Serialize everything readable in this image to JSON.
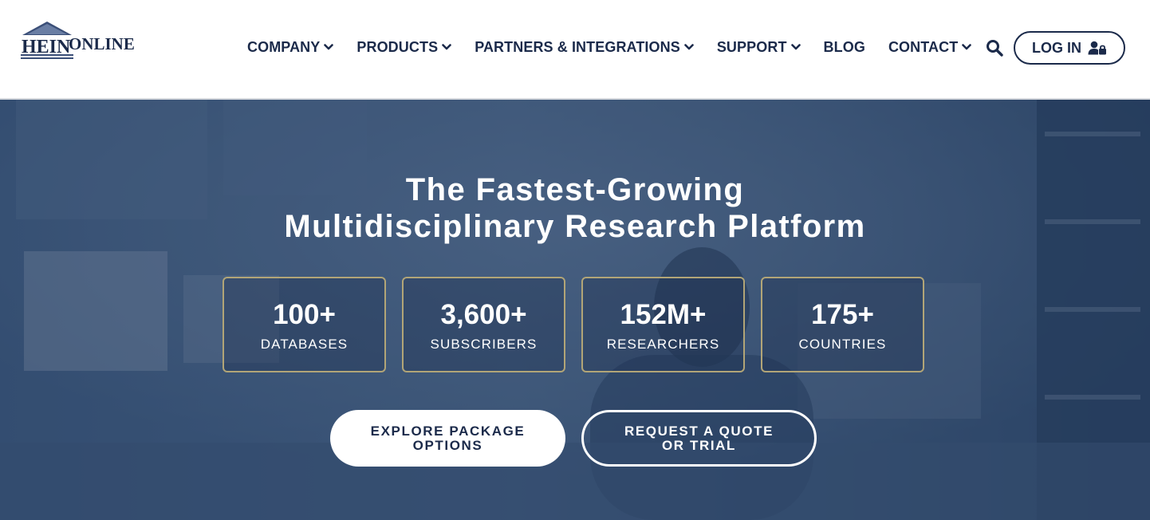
{
  "brand": {
    "logo_text_primary": "HEIN",
    "logo_text_secondary": "ONLINE",
    "colors": {
      "navy": "#1b2a4a",
      "gold": "#b2a577",
      "white": "#ffffff"
    }
  },
  "nav": {
    "items": [
      {
        "label": "COMPANY",
        "has_dropdown": true
      },
      {
        "label": "PRODUCTS",
        "has_dropdown": true
      },
      {
        "label": "PARTNERS & INTEGRATIONS",
        "has_dropdown": true
      },
      {
        "label": "SUPPORT",
        "has_dropdown": true
      },
      {
        "label": "BLOG",
        "has_dropdown": false
      },
      {
        "label": "CONTACT",
        "has_dropdown": true
      }
    ],
    "search_icon": "search-icon",
    "login_label": "LOG IN",
    "login_icon": "user-lock-icon"
  },
  "hero": {
    "title_line1": "The Fastest-Growing",
    "title_line2": "Multidisciplinary Research Platform",
    "stats": [
      {
        "value": "100+",
        "label": "DATABASES"
      },
      {
        "value": "3,600+",
        "label": "SUBSCRIBERS"
      },
      {
        "value": "152M+",
        "label": "RESEARCHERS"
      },
      {
        "value": "175+",
        "label": "COUNTRIES"
      }
    ],
    "primary_button": "EXPLORE PACKAGE OPTIONS",
    "secondary_button": "REQUEST A QUOTE OR TRIAL"
  }
}
